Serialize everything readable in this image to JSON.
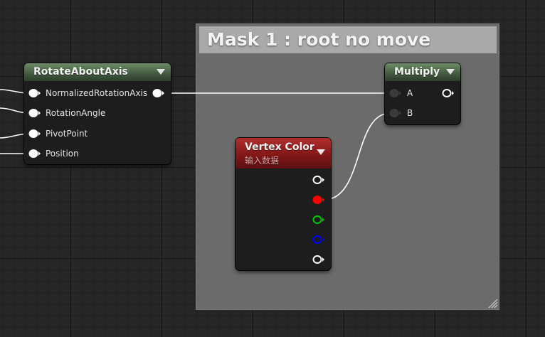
{
  "comment": {
    "title": "Mask 1 : root no move"
  },
  "nodes": {
    "rotate": {
      "title": "RotateAboutAxis",
      "header_color": "#4b6a46",
      "inputs": [
        "NormalizedRotationAxis",
        "RotationAngle",
        "PivotPoint",
        "Position"
      ]
    },
    "multiply": {
      "title": "Multiply",
      "header_color": "#4b6a46",
      "inputs": [
        "A",
        "B"
      ]
    },
    "vertex_color": {
      "title": "Vertex Color",
      "subtitle": "输入数据",
      "header_color": "#8f1c1c",
      "outputs": [
        {
          "channel": "RGB",
          "color": "#ffffff"
        },
        {
          "channel": "R",
          "color": "#ff0000"
        },
        {
          "channel": "G",
          "color": "#00c800"
        },
        {
          "channel": "B",
          "color": "#0000ff"
        },
        {
          "channel": "A",
          "color": "#ffffff"
        }
      ]
    }
  },
  "wire_color": "#ffffff"
}
